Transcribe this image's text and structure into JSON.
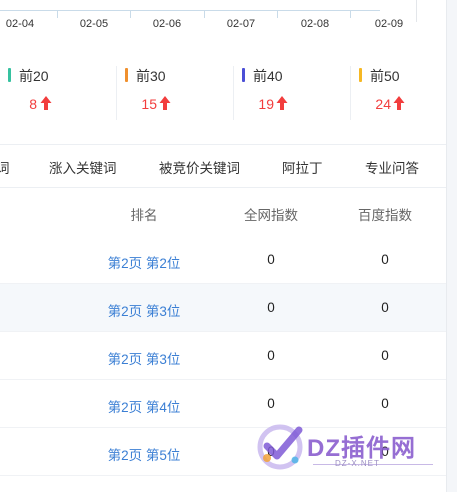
{
  "date_axis": {
    "labels": [
      "02-04",
      "02-05",
      "02-06",
      "02-07",
      "02-08",
      "02-09"
    ]
  },
  "rank_groups": [
    {
      "label": "前20",
      "value": "8",
      "color": "#36c2a0",
      "trend": "arrow-up-icon"
    },
    {
      "label": "前30",
      "value": "15",
      "color": "#f0902e",
      "trend": "arrow-up-icon"
    },
    {
      "label": "前40",
      "value": "19",
      "color": "#4b4fd6",
      "trend": "arrow-up-icon"
    },
    {
      "label": "前50",
      "value": "24",
      "color": "#f6b824",
      "trend": "arrow-up-icon"
    }
  ],
  "tabs": [
    "词",
    "涨入关键词",
    "被竞价关键词",
    "阿拉丁",
    "专业问答"
  ],
  "table": {
    "headers": [
      "排名",
      "全网指数",
      "百度指数"
    ],
    "rows": [
      {
        "rank": "第2页 第2位",
        "net_index": "0",
        "baidu_index": "0"
      },
      {
        "rank": "第2页 第3位",
        "net_index": "0",
        "baidu_index": "0"
      },
      {
        "rank": "第2页 第3位",
        "net_index": "0",
        "baidu_index": "0"
      },
      {
        "rank": "第2页 第4位",
        "net_index": "0",
        "baidu_index": "0"
      },
      {
        "rank": "第2页 第5位",
        "net_index": "0",
        "baidu_index": "0"
      }
    ]
  },
  "watermark": {
    "brand": "DZ插件网",
    "site": "DZ-X.NET"
  },
  "colors": {
    "accent_link": "#3b7fd4",
    "trend_up": "#f23d3d"
  }
}
